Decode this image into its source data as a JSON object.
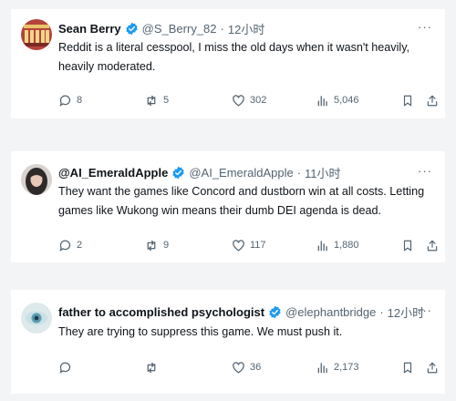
{
  "tweets": [
    {
      "name": "Sean Berry",
      "handle": "@S_Berry_82",
      "separator": "·",
      "time": "12小时",
      "lines": [
        "Reddit is a literal cesspool, I miss the old days when it wasn't heavily,",
        "heavily moderated."
      ],
      "replies": "8",
      "reposts": "5",
      "likes": "302",
      "views": "5,046",
      "avatar_color": "#b5433a"
    },
    {
      "name": "@AI_EmeraldApple",
      "handle": "@AI_EmeraldApple",
      "separator": "·",
      "time": "11小时",
      "lines": [
        "They want the games like Concord and dustborn win at all costs. Letting",
        "games like Wukong win means their dumb DEI agenda is dead."
      ],
      "replies": "2",
      "reposts": "9",
      "likes": "117",
      "views": "1,880",
      "avatar_color": "#2f2a2a"
    },
    {
      "name": "father to accomplished psychologist",
      "handle": "@elephantbridge",
      "separator": "·",
      "time": "12小时",
      "lines": [
        "They are trying to suppress this game. We must push it."
      ],
      "replies": "",
      "reposts": "",
      "likes": "36",
      "views": "2,173",
      "avatar_color": "#c9e0e4"
    }
  ],
  "icons": {
    "verified": "verified-badge-icon",
    "more": "more-options-icon",
    "reply": "reply-icon",
    "repost": "repost-icon",
    "like": "heart-icon",
    "views": "views-chart-icon",
    "bookmark": "bookmark-icon",
    "share": "share-icon"
  },
  "colors": {
    "verified_blue": "#1d9bf0",
    "text_primary": "#0f1419",
    "text_secondary": "#536471"
  },
  "more_glyph": "···"
}
